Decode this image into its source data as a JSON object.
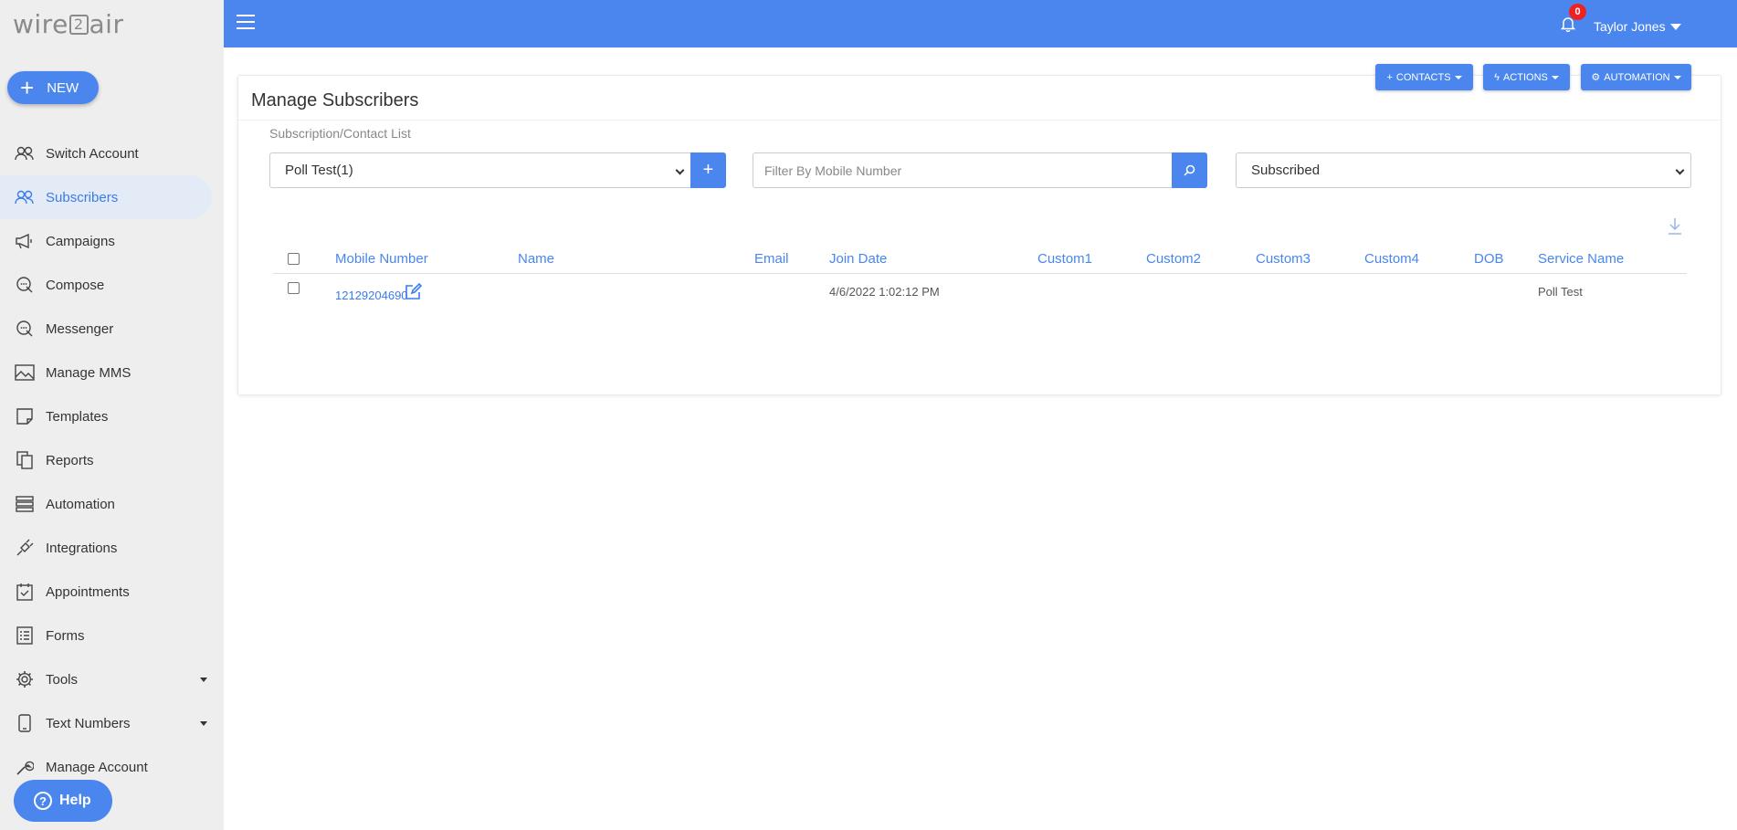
{
  "app": {
    "logo_text_left": "wire",
    "logo_text_mid": "2",
    "logo_text_right": "air",
    "new_label": "NEW",
    "help_label": "Help"
  },
  "sidebar": {
    "items": [
      {
        "label": "Switch Account",
        "icon": "users-icon",
        "active": false
      },
      {
        "label": "Subscribers",
        "icon": "users-icon",
        "active": true
      },
      {
        "label": "Campaigns",
        "icon": "megaphone-icon",
        "active": false
      },
      {
        "label": "Compose",
        "icon": "compose-chat-icon",
        "active": false
      },
      {
        "label": "Messenger",
        "icon": "messenger-chat-icon",
        "active": false
      },
      {
        "label": "Manage MMS",
        "icon": "image-icon",
        "active": false
      },
      {
        "label": "Templates",
        "icon": "note-icon",
        "active": false
      },
      {
        "label": "Reports",
        "icon": "copy-pages-icon",
        "active": false
      },
      {
        "label": "Automation",
        "icon": "server-stack-icon",
        "active": false
      },
      {
        "label": "Integrations",
        "icon": "plug-icon",
        "active": false
      },
      {
        "label": "Appointments",
        "icon": "calendar-check-icon",
        "active": false
      },
      {
        "label": "Forms",
        "icon": "form-list-icon",
        "active": false
      },
      {
        "label": "Tools",
        "icon": "gear-icon",
        "active": false,
        "has_dropdown": true
      },
      {
        "label": "Text Numbers",
        "icon": "phone-icon",
        "active": false,
        "has_dropdown": true
      },
      {
        "label": "Manage Account",
        "icon": "wrench-icon",
        "active": false
      }
    ]
  },
  "topbar": {
    "notification_count": "0",
    "user_name": "Taylor Jones"
  },
  "header_buttons": {
    "contacts": "CONTACTS",
    "actions": "ACTIONS",
    "automation": "AUTOMATION"
  },
  "page": {
    "title": "Manage Subscribers",
    "list_label": "Subscription/Contact List",
    "list_selected": "Poll Test(1)",
    "search_placeholder": "Filter By Mobile Number",
    "status_selected": "Subscribed"
  },
  "table": {
    "columns": [
      "Mobile Number",
      "Name",
      "Email",
      "Join Date",
      "Custom1",
      "Custom2",
      "Custom3",
      "Custom4",
      "DOB",
      "Service Name"
    ],
    "rows": [
      {
        "mobile": "12129204690",
        "name": "",
        "email": "",
        "join_date": "4/6/2022 1:02:12 PM",
        "custom1": "",
        "custom2": "",
        "custom3": "",
        "custom4": "",
        "dob": "",
        "service_name": "Poll Test"
      }
    ]
  },
  "colors": {
    "accent": "#4a86ee",
    "sidebar_bg": "#eeeeee",
    "badge": "#e22222"
  }
}
